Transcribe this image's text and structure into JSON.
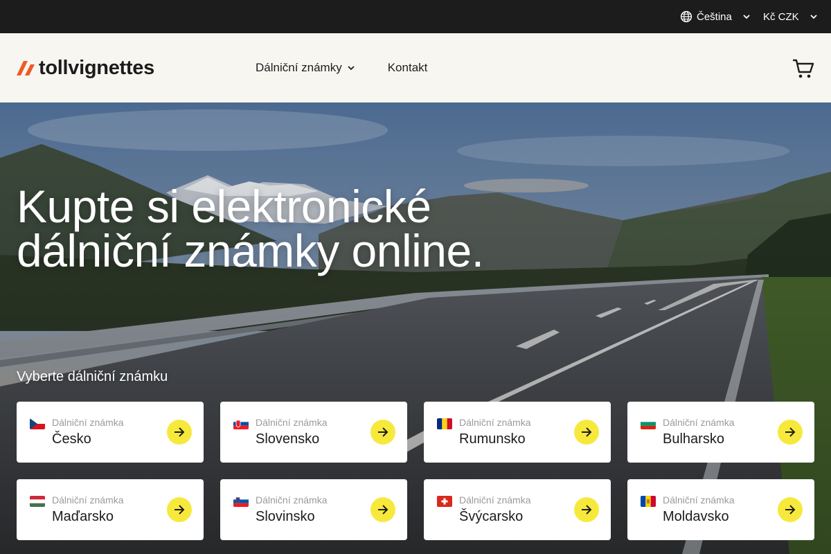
{
  "topbar": {
    "language": "Čeština",
    "currency": "Kč CZK"
  },
  "header": {
    "logo_text": "tollvignettes",
    "nav": [
      {
        "label": "Dálniční známky"
      },
      {
        "label": "Kontakt"
      }
    ]
  },
  "hero": {
    "title": "Kupte si elektronické dálniční známky online.",
    "subtitle": "Vyberte dálniční známku"
  },
  "cards": [
    {
      "small": "Dálniční známka",
      "country": "Česko",
      "flag": "cz"
    },
    {
      "small": "Dálniční známka",
      "country": "Slovensko",
      "flag": "sk"
    },
    {
      "small": "Dálniční známka",
      "country": "Rumunsko",
      "flag": "ro"
    },
    {
      "small": "Dálniční známka",
      "country": "Bulharsko",
      "flag": "bg"
    },
    {
      "small": "Dálniční známka",
      "country": "Maďarsko",
      "flag": "hu"
    },
    {
      "small": "Dálniční známka",
      "country": "Slovinsko",
      "flag": "si"
    },
    {
      "small": "Dálniční známka",
      "country": "Švýcarsko",
      "flag": "ch"
    },
    {
      "small": "Dálniční známka",
      "country": "Moldavsko",
      "flag": "md"
    }
  ],
  "colors": {
    "topbar_bg": "#1c1c1c",
    "header_bg": "#f7f6f1",
    "logo_accent": "#ef5a24",
    "arrow_button": "#f7e93c"
  },
  "icons": {
    "language": "globe-icon",
    "dropdown": "chevron-down-icon",
    "cart": "cart-icon",
    "card_action": "arrow-right-icon"
  }
}
